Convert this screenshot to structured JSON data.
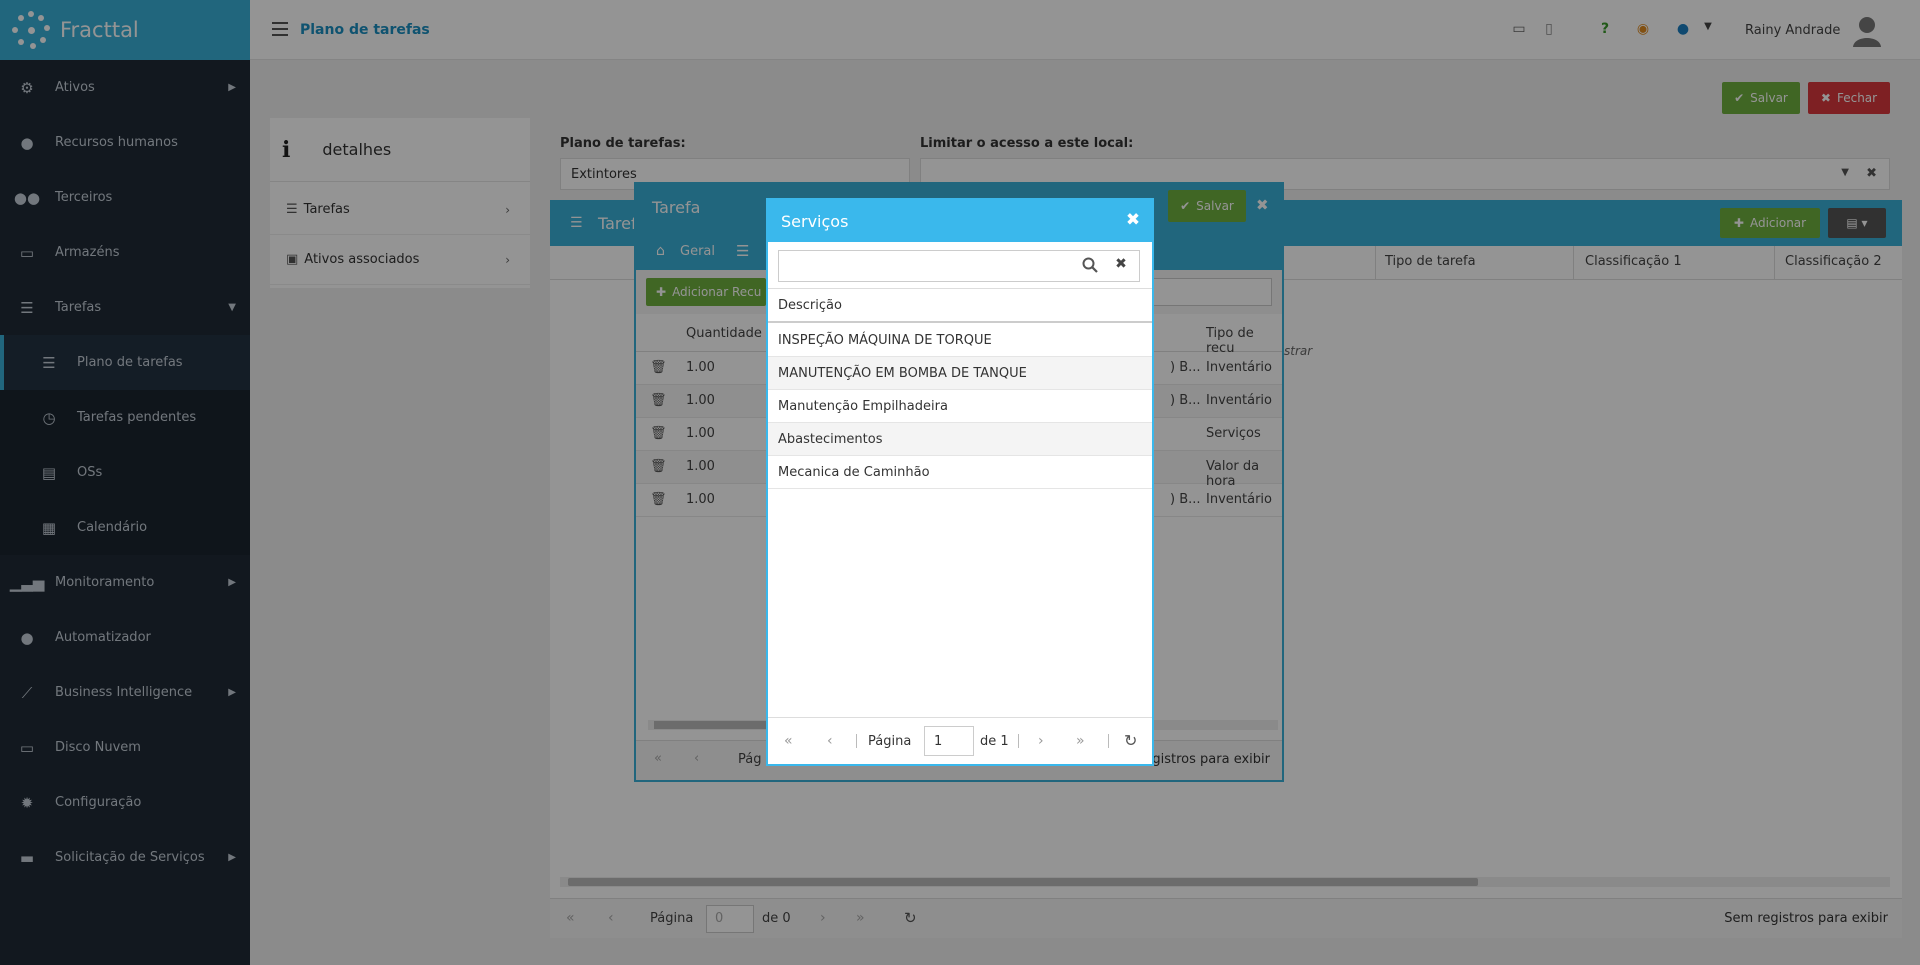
{
  "app": {
    "name": "Fracttal"
  },
  "topbar": {
    "page_title": "Plano de tarefas",
    "user_name": "Rainy Andrade"
  },
  "sidebar": {
    "items": [
      {
        "label": "Ativos",
        "icon": "assets-icon"
      },
      {
        "label": "Recursos humanos",
        "icon": "person-icon"
      },
      {
        "label": "Terceiros",
        "icon": "users-icon"
      },
      {
        "label": "Armazéns",
        "icon": "inbox-icon"
      },
      {
        "label": "Tarefas",
        "icon": "tasks-icon"
      },
      {
        "label": "Plano de tarefas",
        "icon": "list-icon"
      },
      {
        "label": "Tarefas pendentes",
        "icon": "clock-icon"
      },
      {
        "label": "OSs",
        "icon": "document-icon"
      },
      {
        "label": "Calendário",
        "icon": "calendar-icon"
      },
      {
        "label": "Monitoramento",
        "icon": "signal-icon"
      },
      {
        "label": "Automatizador",
        "icon": "chat-icon"
      },
      {
        "label": "Business Intelligence",
        "icon": "chart-icon"
      },
      {
        "label": "Disco Nuvem",
        "icon": "drive-icon"
      },
      {
        "label": "Configuração",
        "icon": "gear-icon"
      },
      {
        "label": "Solicitação de Serviços",
        "icon": "request-icon"
      }
    ]
  },
  "header_buttons": {
    "save": "Salvar",
    "close": "Fechar"
  },
  "details": {
    "title": "detalhes",
    "items": [
      "Tarefas",
      "Ativos associados"
    ]
  },
  "form": {
    "plan_label": "Plano de tarefas:",
    "plan_value": "Extintores",
    "location_label": "Limitar o acesso a este local:"
  },
  "tasks_panel": {
    "title": "Tarefas",
    "add_label": "Adicionar",
    "columns": [
      "Tipo de tarefa",
      "Classificação 1",
      "Classificação 2"
    ],
    "empty_hint": "strar",
    "pager": {
      "page_label": "Página",
      "page_value": "0",
      "of_label": "de 0",
      "status": "Sem registros para exibir"
    }
  },
  "tarefa_modal": {
    "title": "Tarefa",
    "save_label": "Salvar",
    "tab_general": "Geral",
    "add_resource_label": "Adicionar Recu",
    "columns": [
      "Quantidade",
      "Tipo de recu"
    ],
    "rows": [
      {
        "qty": "1.00",
        "mid": ") B...",
        "type": "Inventário"
      },
      {
        "qty": "1.00",
        "mid": ") B...",
        "type": "Inventário"
      },
      {
        "qty": "1.00",
        "mid": "",
        "type": "Serviços"
      },
      {
        "qty": "1.00",
        "mid": "",
        "type": "Valor da hora"
      },
      {
        "qty": "1.00",
        "mid": ") B...",
        "type": "Inventário"
      }
    ],
    "pager_page_prefix": "Pág",
    "pager_status": "egistros para exibir"
  },
  "servicos_dialog": {
    "title": "Serviços",
    "search_placeholder": "",
    "column": "Descrição",
    "rows": [
      "INSPEÇÃO MÁQUINA DE TORQUE",
      "MANUTENÇÃO EM BOMBA DE TANQUE",
      "Manutenção Empilhadeira",
      "Abastecimentos",
      "Mecanica de Caminhão"
    ],
    "pager": {
      "page_label": "Página",
      "page_value": "1",
      "of_label": "de 1"
    }
  },
  "colors": {
    "accent": "#3ab0d8",
    "dialog_header": "#3ab8ec",
    "save": "#6fb03f",
    "close": "#d9383d",
    "sidebar": "#1f2a36"
  }
}
